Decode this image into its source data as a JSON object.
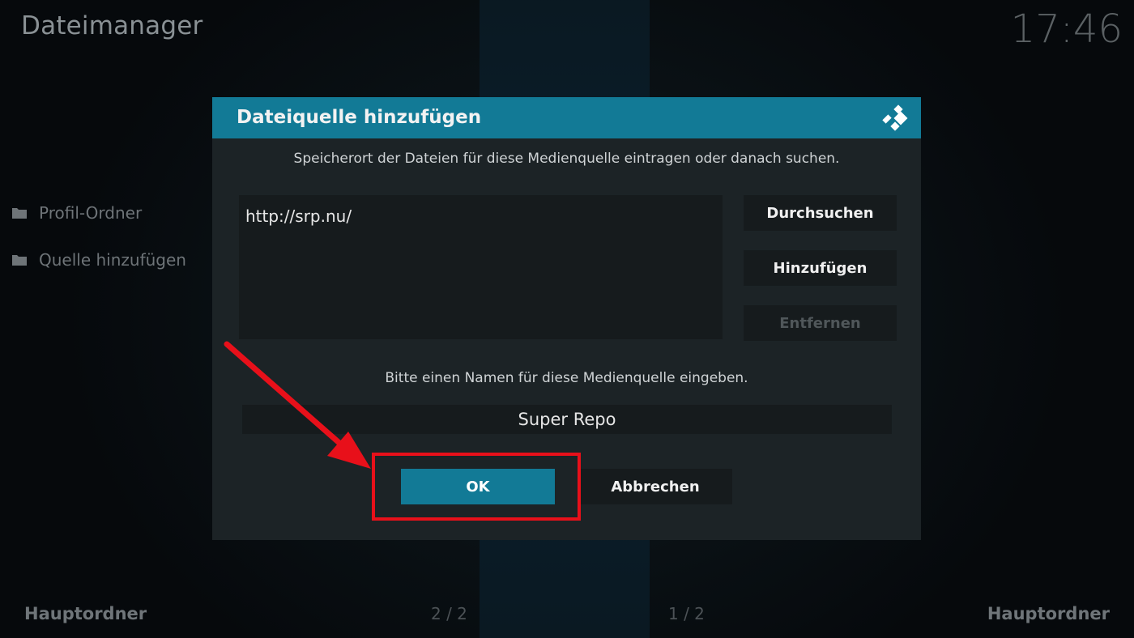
{
  "app": {
    "title": "Dateimanager",
    "clock": "17:46"
  },
  "sidebar": {
    "items": [
      {
        "label": "Profil-Ordner",
        "icon": "folder-icon"
      },
      {
        "label": "Quelle hinzufügen",
        "icon": "folder-icon"
      }
    ]
  },
  "footer": {
    "left_label": "Hauptordner",
    "left_page": "2 / 2",
    "right_page": "1 / 2",
    "right_label": "Hauptordner"
  },
  "dialog": {
    "title": "Dateiquelle hinzufügen",
    "logo_icon": "kodi-logo-icon",
    "path_hint": "Speicherort der Dateien für diese Medienquelle eintragen oder danach suchen.",
    "path_value": "http://srp.nu/",
    "buttons": {
      "browse": "Durchsuchen",
      "add": "Hinzufügen",
      "remove": "Entfernen"
    },
    "name_hint": "Bitte einen Namen für diese Medienquelle eingeben.",
    "name_value": "Super Repo",
    "ok": "OK",
    "cancel": "Abbrechen"
  },
  "colors": {
    "accent": "#127a96",
    "dialog_bg": "#1c2326",
    "annotation_red": "#e8101a"
  }
}
